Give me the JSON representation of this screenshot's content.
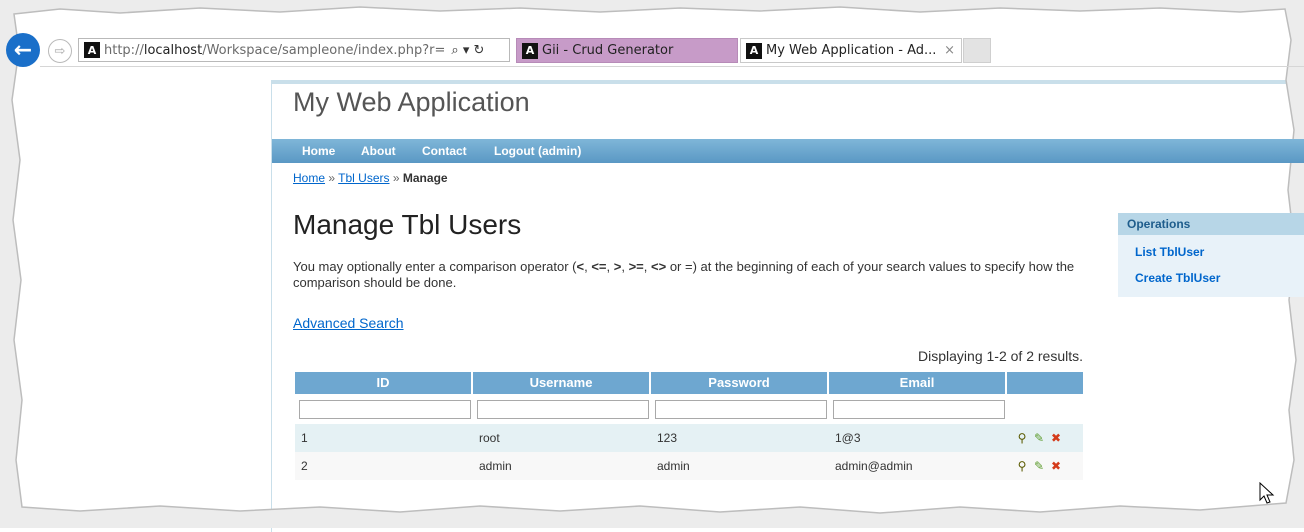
{
  "browser": {
    "url_prefix": "http://",
    "url_host": "localhost",
    "url_path": "/Workspace/sampleone/index.php?r=",
    "address_tools": "⌕ ▾ ↻",
    "tabs": [
      {
        "label": "Gii - Crud Generator"
      },
      {
        "label": "My Web Application - Ad..."
      }
    ],
    "tab_close": "×"
  },
  "app": {
    "title": "My Web Application"
  },
  "nav": {
    "items": [
      "Home",
      "About",
      "Contact",
      "Logout (admin)"
    ]
  },
  "breadcrumb": {
    "home": "Home",
    "sep": "»",
    "section": "Tbl Users",
    "current": "Manage"
  },
  "page": {
    "heading": "Manage Tbl Users",
    "hint_pre": "You may optionally enter a comparison operator (",
    "hint_ops": [
      "<",
      "<=",
      ">",
      ">=",
      "<>",
      "="
    ],
    "hint_post": ") at the beginning of each of your search values to specify how the comparison should be done.",
    "advanced_search": "Advanced Search",
    "summary": "Displaying 1-2 of 2 results."
  },
  "grid": {
    "columns": [
      "ID",
      "Username",
      "Password",
      "Email",
      ""
    ],
    "rows": [
      {
        "id": "1",
        "username": "root",
        "password": "123",
        "email": "1@3"
      },
      {
        "id": "2",
        "username": "admin",
        "password": "admin",
        "email": "admin@admin"
      }
    ],
    "action_icons": [
      "view-icon",
      "update-icon",
      "delete-icon"
    ]
  },
  "operations": {
    "title": "Operations",
    "items": [
      "List TblUser",
      "Create TblUser"
    ]
  },
  "colors": {
    "nav": "#5a98c4",
    "link": "#0066cc",
    "row_odd": "#e5f1f4",
    "tab_active": "#c79bc8"
  }
}
